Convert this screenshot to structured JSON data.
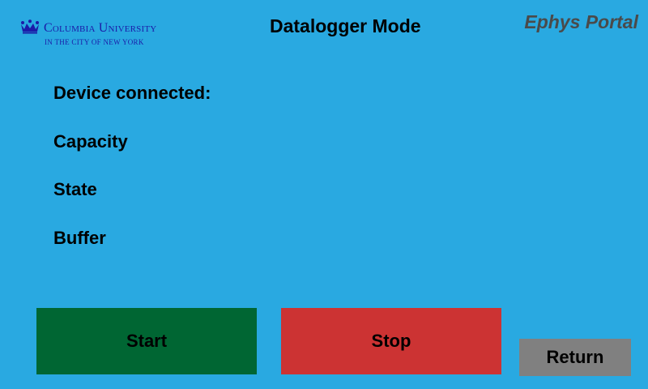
{
  "logo": {
    "name": "Columbia University",
    "subtitle": "IN THE CITY OF NEW YORK",
    "icon": "crown-icon",
    "color": "#1b1ba8"
  },
  "header": {
    "title": "Datalogger Mode",
    "portal": "Ephys Portal"
  },
  "status": {
    "device_label": "Device connected:",
    "capacity_label": "Capacity",
    "state_label": "State",
    "buffer_label": "Buffer"
  },
  "buttons": {
    "start_label": "Start",
    "stop_label": "Stop",
    "return_label": "Return"
  },
  "colors": {
    "background": "#29a9e1",
    "start": "#006633",
    "stop": "#cc3333",
    "return": "#808080",
    "portal_text": "#4a4a4a"
  }
}
